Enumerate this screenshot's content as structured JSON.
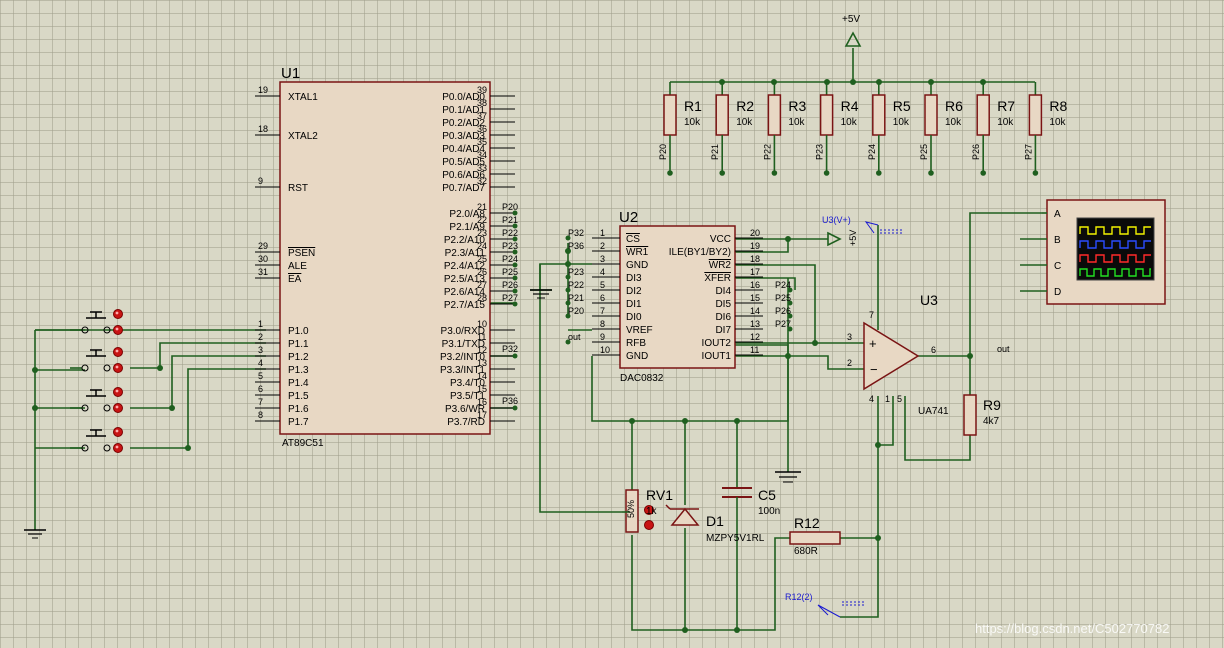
{
  "u1": {
    "ref": "U1",
    "part": "AT89C51",
    "left_pins": [
      {
        "num": "19",
        "name": "XTAL1"
      },
      {
        "num": "18",
        "name": "XTAL2"
      },
      {
        "num": "9",
        "name": "RST"
      },
      {
        "num": "29",
        "name": "PSEN"
      },
      {
        "num": "30",
        "name": "ALE"
      },
      {
        "num": "31",
        "name": "EA"
      },
      {
        "num": "1",
        "name": "P1.0"
      },
      {
        "num": "2",
        "name": "P1.1"
      },
      {
        "num": "3",
        "name": "P1.2"
      },
      {
        "num": "4",
        "name": "P1.3"
      },
      {
        "num": "5",
        "name": "P1.4"
      },
      {
        "num": "6",
        "name": "P1.5"
      },
      {
        "num": "7",
        "name": "P1.6"
      },
      {
        "num": "8",
        "name": "P1.7"
      }
    ],
    "right_pins": [
      {
        "num": "39",
        "name": "P0.0/AD0"
      },
      {
        "num": "38",
        "name": "P0.1/AD1"
      },
      {
        "num": "37",
        "name": "P0.2/AD2"
      },
      {
        "num": "36",
        "name": "P0.3/AD3"
      },
      {
        "num": "35",
        "name": "P0.4/AD4"
      },
      {
        "num": "34",
        "name": "P0.5/AD5"
      },
      {
        "num": "33",
        "name": "P0.6/AD6"
      },
      {
        "num": "32",
        "name": "P0.7/AD7"
      },
      {
        "num": "21",
        "name": "P2.0/A8"
      },
      {
        "num": "22",
        "name": "P2.1/A9"
      },
      {
        "num": "23",
        "name": "P2.2/A10"
      },
      {
        "num": "24",
        "name": "P2.3/A11"
      },
      {
        "num": "25",
        "name": "P2.4/A12"
      },
      {
        "num": "26",
        "name": "P2.5/A13"
      },
      {
        "num": "27",
        "name": "P2.6/A14"
      },
      {
        "num": "28",
        "name": "P2.7/A15"
      },
      {
        "num": "10",
        "name": "P3.0/RXD"
      },
      {
        "num": "11",
        "name": "P3.1/TXD"
      },
      {
        "num": "12",
        "name": "P3.2/INT0"
      },
      {
        "num": "13",
        "name": "P3.3/INT1"
      },
      {
        "num": "14",
        "name": "P3.4/T0"
      },
      {
        "num": "15",
        "name": "P3.5/T1"
      },
      {
        "num": "16",
        "name": "P3.6/WR"
      },
      {
        "num": "17",
        "name": "P3.7/RD"
      }
    ],
    "p2_nets": [
      "P20",
      "P21",
      "P22",
      "P23",
      "P24",
      "P25",
      "P26",
      "P27"
    ],
    "p3_nets": [
      "P32",
      "P36"
    ]
  },
  "u2": {
    "ref": "U2",
    "part": "DAC0832",
    "left_pins": [
      {
        "num": "1",
        "name": "CS",
        "net": "P32"
      },
      {
        "num": "2",
        "name": "WR1",
        "net": "P36"
      },
      {
        "num": "3",
        "name": "GND",
        "net": ""
      },
      {
        "num": "4",
        "name": "DI3",
        "net": "P23"
      },
      {
        "num": "5",
        "name": "DI2",
        "net": "P22"
      },
      {
        "num": "6",
        "name": "DI1",
        "net": "P21"
      },
      {
        "num": "7",
        "name": "DI0",
        "net": "P20"
      },
      {
        "num": "8",
        "name": "VREF",
        "net": ""
      },
      {
        "num": "9",
        "name": "RFB",
        "net": "out"
      },
      {
        "num": "10",
        "name": "GND",
        "net": ""
      }
    ],
    "right_pins": [
      {
        "num": "20",
        "name": "VCC",
        "net": ""
      },
      {
        "num": "19",
        "name": "ILE(BY1/BY2)",
        "net": ""
      },
      {
        "num": "18",
        "name": "WR2",
        "net": ""
      },
      {
        "num": "17",
        "name": "XFER",
        "net": ""
      },
      {
        "num": "16",
        "name": "DI4",
        "net": "P24"
      },
      {
        "num": "15",
        "name": "DI5",
        "net": "P25"
      },
      {
        "num": "14",
        "name": "DI6",
        "net": "P26"
      },
      {
        "num": "13",
        "name": "DI7",
        "net": "P27"
      },
      {
        "num": "12",
        "name": "IOUT2",
        "net": ""
      },
      {
        "num": "11",
        "name": "IOUT1",
        "net": ""
      }
    ]
  },
  "u3": {
    "ref": "U3",
    "part": "UA741",
    "pins": {
      "in_plus": "3",
      "in_minus": "2",
      "out": "6",
      "vplus": "7",
      "vminus": "4",
      "p1": "1",
      "p5": "5"
    },
    "out_net": "out"
  },
  "power": {
    "label": "+5V"
  },
  "resistors": [
    {
      "ref": "R1",
      "value": "10k",
      "net": "P20"
    },
    {
      "ref": "R2",
      "value": "10k",
      "net": "P21"
    },
    {
      "ref": "R3",
      "value": "10k",
      "net": "P22"
    },
    {
      "ref": "R4",
      "value": "10k",
      "net": "P23"
    },
    {
      "ref": "R5",
      "value": "10k",
      "net": "P24"
    },
    {
      "ref": "R6",
      "value": "10k",
      "net": "P25"
    },
    {
      "ref": "R7",
      "value": "10k",
      "net": "P26"
    },
    {
      "ref": "R8",
      "value": "10k",
      "net": "P27"
    }
  ],
  "r9": {
    "ref": "R9",
    "value": "4k7"
  },
  "r12": {
    "ref": "R12",
    "value": "680R"
  },
  "rv1": {
    "ref": "RV1",
    "value": "1k",
    "pct": "50%"
  },
  "c5": {
    "ref": "C5",
    "value": "100n"
  },
  "d1": {
    "ref": "D1",
    "part": "MZPY5V1RL"
  },
  "probes": {
    "u3_vplus": "U3(V+)",
    "u3_vplus_val": "+5V",
    "r12_2": "R12(2)"
  },
  "scope": {
    "channels": [
      "A",
      "B",
      "C",
      "D"
    ],
    "trace_colors": [
      "#f2f200",
      "#2a4cff",
      "#ff2a2a",
      "#22e022"
    ]
  },
  "watermark": "https://blog.csdn.net/C502770782"
}
